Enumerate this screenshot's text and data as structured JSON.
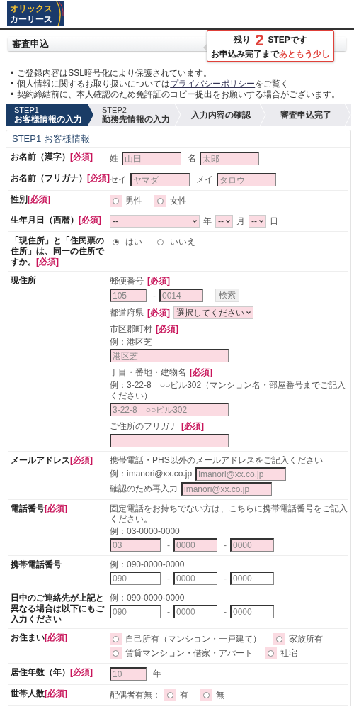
{
  "logo": {
    "line1": "オリックス",
    "line2": "カーリース"
  },
  "page_title": "審査申込",
  "popup": {
    "prefix": "残り",
    "count": "2",
    "suffix": "STEPです",
    "message": "お申込み完了まで",
    "emphasis": "あともう少し"
  },
  "notices": [
    {
      "kind": "plain",
      "bullet": "•",
      "text": "ご登録内容はSSL暗号化により保護されています。"
    },
    {
      "kind": "link",
      "bullet": "•",
      "before": "個人情報に関するお取り扱いについては",
      "link": "プライバシーポリシー",
      "after": "をご覧く"
    },
    {
      "kind": "plain",
      "bullet": "•",
      "text": "契約締結前に、本人確認のため免許証のコピー提出をお願いする場合がございます。"
    }
  ],
  "steps": [
    {
      "step": "STEP1",
      "label": "お客様情報の入力",
      "selected": true
    },
    {
      "step": "STEP2",
      "label": "勤務先情報の入力",
      "selected": false
    },
    {
      "label": "入力内容の確認",
      "selected": false
    },
    {
      "label": "審査申込完了",
      "selected": false
    }
  ],
  "section_title": "STEP1 お客様情報",
  "rows": [
    {
      "label": "お名前（漢字）",
      "required": "[必須]",
      "groups": [
        [
          [
            {
              "kind": "text",
              "text": "姓"
            },
            {
              "kind": "input",
              "placeholder": "山田",
              "required": true
            },
            {
              "kind": "text",
              "text": "名"
            },
            {
              "kind": "input",
              "placeholder": "太郎",
              "required": true
            }
          ]
        ]
      ]
    },
    {
      "label": "お名前（フリガナ）",
      "required": "[必須]",
      "groups": [
        [
          [
            {
              "kind": "text",
              "text": "セイ"
            },
            {
              "kind": "input",
              "placeholder": "ヤマダ",
              "required": true
            },
            {
              "kind": "text",
              "text": "メイ"
            },
            {
              "kind": "input",
              "placeholder": "タロウ",
              "required": true
            }
          ]
        ]
      ]
    },
    {
      "label": "性別",
      "required": "[必須]",
      "groups": [
        [
          [
            {
              "kind": "radio",
              "label": "男性",
              "selected": false,
              "required": true
            },
            {
              "kind": "radio",
              "label": "女性",
              "selected": false,
              "required": true
            }
          ]
        ]
      ]
    },
    {
      "label": "生年月日（西暦）",
      "required": "[必須]",
      "groups": [
        [
          [
            {
              "kind": "select",
              "value": "--",
              "required": true
            },
            {
              "kind": "text",
              "text": "年"
            },
            {
              "kind": "select",
              "value": "--",
              "required": true
            },
            {
              "kind": "text",
              "text": "月"
            },
            {
              "kind": "select",
              "value": "--",
              "required": true
            },
            {
              "kind": "text",
              "text": "日"
            }
          ]
        ]
      ]
    },
    {
      "label": "「現住所」と「住民票の住所」は、同一の住所ですか。",
      "required": "[必須]",
      "groups": [
        [
          [
            {
              "kind": "radio",
              "label": "はい",
              "selected": true,
              "required": false
            },
            {
              "kind": "radio",
              "label": "いいえ",
              "selected": false,
              "required": false
            }
          ]
        ]
      ]
    },
    {
      "label": "現住所",
      "groups": [
        [
          [
            {
              "kind": "text",
              "text": "郵便番号"
            },
            {
              "kind": "req",
              "text": "[必須]"
            }
          ],
          [
            {
              "kind": "input",
              "placeholder": "105",
              "required": true
            },
            {
              "kind": "sep",
              "text": "-"
            },
            {
              "kind": "input",
              "placeholder": "0014",
              "required": true
            },
            {
              "kind": "button",
              "label": "検索",
              "disabled": true
            }
          ]
        ],
        [
          [
            {
              "kind": "text",
              "text": "都道府県"
            },
            {
              "kind": "req",
              "text": "[必須]"
            },
            {
              "kind": "select",
              "value": "選択してください",
              "required": true
            }
          ]
        ],
        [
          [
            {
              "kind": "text",
              "text": "市区郡町村"
            },
            {
              "kind": "req",
              "text": "[必須]"
            }
          ],
          [
            {
              "kind": "text",
              "text": "例：港区芝"
            }
          ],
          [
            {
              "kind": "input",
              "placeholder": "港区芝",
              "required": true
            }
          ]
        ],
        [
          [
            {
              "kind": "text",
              "text": "丁目・番地・建物名"
            },
            {
              "kind": "req",
              "text": "[必須]"
            }
          ],
          [
            {
              "kind": "text",
              "text": "例：3-22-8　○○ビル302（マンション名・部屋番号までご記入ください）"
            }
          ],
          [
            {
              "kind": "input",
              "placeholder": "3-22-8　○○ビル302",
              "required": true
            }
          ]
        ],
        [
          [
            {
              "kind": "text",
              "text": "ご住所のフリガナ"
            },
            {
              "kind": "req",
              "text": "[必須]"
            }
          ],
          [
            {
              "kind": "input",
              "required": true
            }
          ]
        ]
      ]
    },
    {
      "label": "メールアドレス",
      "required": "[必須]",
      "groups": [
        [
          [
            {
              "kind": "text",
              "text": "携帯電話・PHS以外のメールアドレスをご記入ください"
            }
          ],
          [
            {
              "kind": "text",
              "text": "例：imanori@xx.co.jp"
            },
            {
              "kind": "input",
              "placeholder": "imanori@xx.co.jp",
              "required": true
            }
          ],
          [
            {
              "kind": "text",
              "text": "確認のため再入力"
            },
            {
              "kind": "input",
              "placeholder": "imanori@xx.co.jp",
              "required": true
            }
          ]
        ]
      ]
    },
    {
      "label": "電話番号",
      "required": "[必須]",
      "groups": [
        [
          [
            {
              "kind": "text",
              "text": "固定電話をお持ちでない方は、こちらに携帯電話番号をご記入ください。"
            }
          ],
          [
            {
              "kind": "text",
              "text": "例：03-0000-0000"
            }
          ],
          [
            {
              "kind": "input",
              "placeholder": "03",
              "required": true
            },
            {
              "kind": "sep",
              "text": "-"
            },
            {
              "kind": "input",
              "placeholder": "0000",
              "required": true
            },
            {
              "kind": "sep",
              "text": "-"
            },
            {
              "kind": "input",
              "placeholder": "0000",
              "required": true
            }
          ]
        ]
      ]
    },
    {
      "label": "携帯電話番号",
      "groups": [
        [
          [
            {
              "kind": "text",
              "text": "例：090-0000-0000"
            }
          ],
          [
            {
              "kind": "input",
              "placeholder": "090",
              "required": false
            },
            {
              "kind": "sep",
              "text": "-"
            },
            {
              "kind": "input",
              "placeholder": "0000",
              "required": false
            },
            {
              "kind": "sep",
              "text": "-"
            },
            {
              "kind": "input",
              "placeholder": "0000",
              "required": false
            }
          ]
        ]
      ]
    },
    {
      "label": "日中のご連絡先が上記と異なる場合は以下にもご入力ください",
      "groups": [
        [
          [
            {
              "kind": "text",
              "text": "例：090-0000-0000"
            }
          ],
          [
            {
              "kind": "input",
              "placeholder": "090",
              "required": false
            },
            {
              "kind": "sep",
              "text": "-"
            },
            {
              "kind": "input",
              "placeholder": "0000",
              "required": false
            },
            {
              "kind": "sep",
              "text": "-"
            },
            {
              "kind": "input",
              "placeholder": "0000",
              "required": false
            }
          ]
        ]
      ]
    },
    {
      "label": "お住まい",
      "required": "[必須]",
      "groups": [
        [
          [
            {
              "kind": "radio",
              "label": "自己所有（マンション・一戸建て）",
              "selected": false,
              "required": true
            },
            {
              "kind": "radio",
              "label": "家族所有",
              "selected": false,
              "required": true
            }
          ],
          [
            {
              "kind": "radio",
              "label": "賃貸マンション・借家・アパート",
              "selected": false,
              "required": true
            },
            {
              "kind": "radio",
              "label": "社宅",
              "selected": false,
              "required": true
            }
          ]
        ]
      ]
    },
    {
      "label": "居住年数（年）",
      "required": "[必須]",
      "groups": [
        [
          [
            {
              "kind": "input",
              "placeholder": "10",
              "required": true
            },
            {
              "kind": "text",
              "text": "年"
            }
          ]
        ]
      ]
    },
    {
      "label": "世帯人数",
      "required": "[必須]",
      "groups": [
        [
          [
            {
              "kind": "text",
              "text": "配偶者有無："
            },
            {
              "kind": "radio",
              "label": "有",
              "selected": false,
              "required": true
            },
            {
              "kind": "radio",
              "label": "無",
              "selected": false,
              "required": true
            }
          ]
        ]
      ]
    }
  ]
}
